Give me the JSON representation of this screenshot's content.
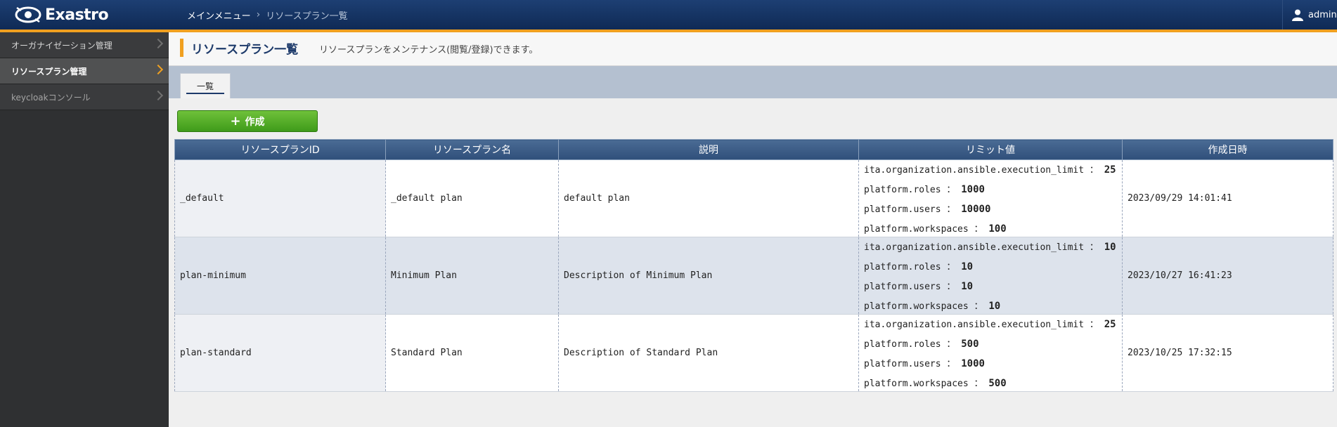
{
  "app": {
    "logo_text": "Exastro"
  },
  "breadcrumb": {
    "main": "メインメニュー",
    "current": "リソースプラン一覧"
  },
  "user": {
    "name": "admin"
  },
  "sidebar": {
    "items": [
      {
        "label": "オーガナイゼーション管理"
      },
      {
        "label": "リソースプラン管理"
      },
      {
        "label": "keycloakコンソール"
      }
    ]
  },
  "page": {
    "title": "リソースプラン一覧",
    "description": "リソースプランをメンテナンス(閲覧/登録)できます。"
  },
  "tabs": [
    {
      "label": "一覧"
    }
  ],
  "toolbar": {
    "create_label": "作成"
  },
  "table": {
    "headers": [
      "リソースプランID",
      "リソースプラン名",
      "説明",
      "リミット値",
      "作成日時"
    ],
    "rows": [
      {
        "id": "_default",
        "name": "_default plan",
        "description": "default plan",
        "limits": [
          {
            "key": "ita.organization.ansible.execution_limit",
            "value": "25"
          },
          {
            "key": "platform.roles",
            "value": "1000"
          },
          {
            "key": "platform.users",
            "value": "10000"
          },
          {
            "key": "platform.workspaces",
            "value": "100"
          }
        ],
        "created": "2023/09/29 14:01:41"
      },
      {
        "id": "plan-minimum",
        "name": "Minimum Plan",
        "description": "Description of Minimum Plan",
        "limits": [
          {
            "key": "ita.organization.ansible.execution_limit",
            "value": "10"
          },
          {
            "key": "platform.roles",
            "value": "10"
          },
          {
            "key": "platform.users",
            "value": "10"
          },
          {
            "key": "platform.workspaces",
            "value": "10"
          }
        ],
        "created": "2023/10/27 16:41:23"
      },
      {
        "id": "plan-standard",
        "name": "Standard Plan",
        "description": "Description of Standard Plan",
        "limits": [
          {
            "key": "ita.organization.ansible.execution_limit",
            "value": "25"
          },
          {
            "key": "platform.roles",
            "value": "500"
          },
          {
            "key": "platform.users",
            "value": "1000"
          },
          {
            "key": "platform.workspaces",
            "value": "500"
          }
        ],
        "created": "2023/10/25 17:32:15"
      }
    ]
  },
  "colors": {
    "header_bg": "#0f2a55",
    "accent": "#f0a020",
    "create_green": "#4fa822",
    "sidebar_bg": "#2f3032"
  }
}
